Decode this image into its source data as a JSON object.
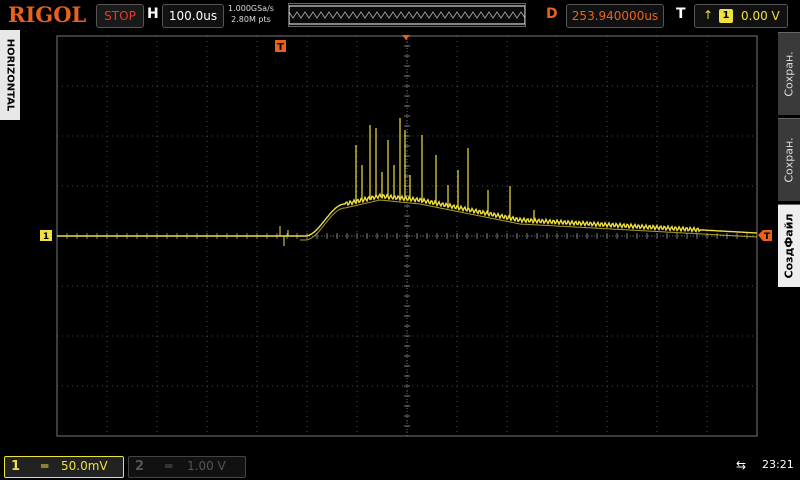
{
  "header": {
    "brand": "RIGOL",
    "run_state": "STOP",
    "h_label": "H",
    "timebase": "100.0us",
    "sample_rate": "1.000GSa/s",
    "mem_depth": "2.80M pts",
    "d_label": "D",
    "delay": "253.940000us",
    "t_label": "T",
    "trigger_channel": "1",
    "trigger_level": "0.00 V"
  },
  "side_tab": {
    "label": "HORIZONTAL"
  },
  "menu": {
    "items": [
      "Сохран.",
      "Сохран.",
      "СоздФайл"
    ],
    "active_index": 2
  },
  "channels": [
    {
      "num": "1",
      "coupling": "═",
      "scale": "50.0mV",
      "active": true
    },
    {
      "num": "2",
      "coupling": "═",
      "scale": "1.00 V",
      "active": false
    }
  ],
  "status": {
    "clock": "23:21",
    "usb_icon": "usb-icon"
  },
  "markers": {
    "channel1": "1",
    "trigger_pos": "T",
    "trigger_level_marker": "T"
  },
  "colors": {
    "ch1": "#f0e040",
    "accent": "#e8621e",
    "grid": "#4a4a4a"
  }
}
